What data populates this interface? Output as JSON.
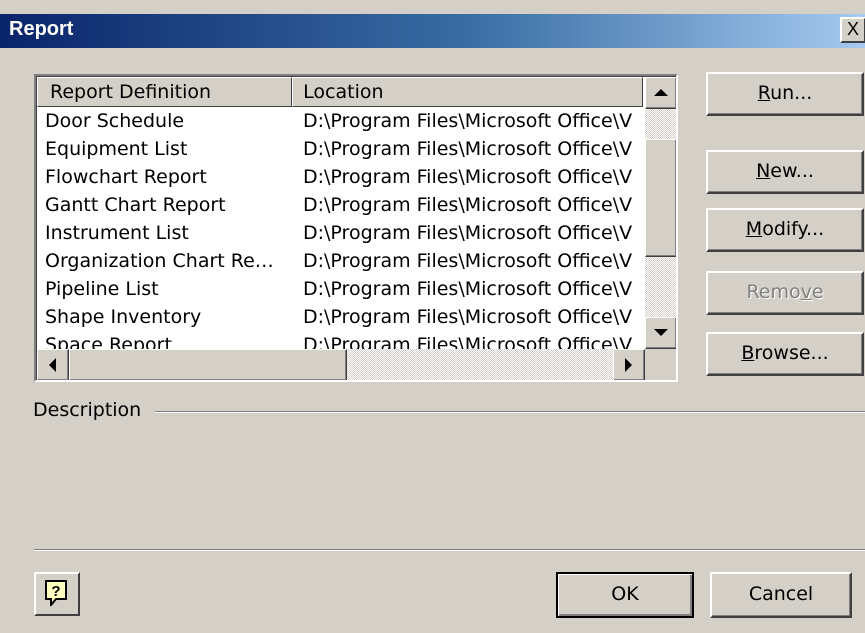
{
  "window": {
    "title": "Report",
    "close_label": "X"
  },
  "list": {
    "columns": [
      "Report Definition",
      "Location"
    ],
    "rows": [
      {
        "definition": "Door Schedule",
        "location": "D:\\Program Files\\Microsoft Office\\V"
      },
      {
        "definition": "Equipment List",
        "location": "D:\\Program Files\\Microsoft Office\\V"
      },
      {
        "definition": "Flowchart Report",
        "location": "D:\\Program Files\\Microsoft Office\\V"
      },
      {
        "definition": "Gantt Chart Report",
        "location": "D:\\Program Files\\Microsoft Office\\V"
      },
      {
        "definition": "Instrument List",
        "location": "D:\\Program Files\\Microsoft Office\\V"
      },
      {
        "definition": "Organization Chart Re…",
        "location": "D:\\Program Files\\Microsoft Office\\V"
      },
      {
        "definition": "Pipeline List",
        "location": "D:\\Program Files\\Microsoft Office\\V"
      },
      {
        "definition": "Shape Inventory",
        "location": "D:\\Program Files\\Microsoft Office\\V"
      },
      {
        "definition": "Space Report",
        "location": "D:\\Program Files\\Microsoft Office\\V"
      }
    ]
  },
  "buttons": {
    "run": {
      "pre": "",
      "key": "R",
      "post": "un..."
    },
    "new": {
      "pre": "",
      "key": "N",
      "post": "ew..."
    },
    "modify": {
      "pre": "",
      "key": "M",
      "post": "odify..."
    },
    "remove": {
      "pre": "Remo",
      "key": "v",
      "post": "e"
    },
    "browse": {
      "pre": "",
      "key": "B",
      "post": "rowse..."
    },
    "ok": "OK",
    "cancel": "Cancel"
  },
  "description": {
    "label": "Description"
  },
  "icons": {
    "help": "help-question-icon",
    "scroll_up": "arrow-up-icon",
    "scroll_down": "arrow-down-icon",
    "scroll_left": "arrow-left-icon",
    "scroll_right": "arrow-right-icon"
  },
  "colors": {
    "title_gradient_start": "#0a246a",
    "title_gradient_end": "#a6caf0",
    "face": "#d4d0c8"
  }
}
